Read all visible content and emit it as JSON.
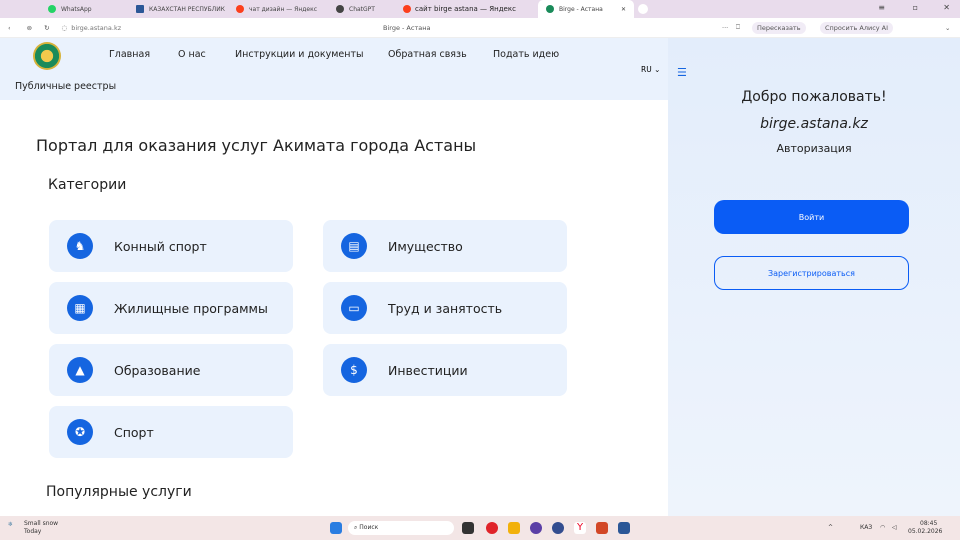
{
  "browser": {
    "tabs": [
      {
        "label": "WhatsApp",
        "color": "#25d366"
      },
      {
        "label": "КАЗАХСТАН РЕСПУБЛИК",
        "color": "#2b5797"
      },
      {
        "label": "чат дизайн — Яндекс",
        "color": "#fc3f1d"
      },
      {
        "label": "ChatGPT",
        "color": "#444"
      },
      {
        "label": "сайт birge astana — Яндекс",
        "color": "#fc3f1d"
      },
      {
        "label": "Birge - Астана",
        "color": "#1a8b5a"
      }
    ],
    "url": "birge.astana.kz",
    "page_title": "Birge - Астана",
    "retell": "Пересказать",
    "ask_alice": "Спросить Алису AI"
  },
  "header": {
    "nav": [
      "Главная",
      "О нас",
      "Инструкции и документы",
      "Обратная связь",
      "Подать идею"
    ],
    "public_registries": "Публичные реестры",
    "lang": "RU"
  },
  "main": {
    "title": "Портал для оказания услуг Акимата города Астаны",
    "categories_title": "Категории",
    "categories": [
      {
        "label": "Конный спорт",
        "icon": "horse-icon"
      },
      {
        "label": "Имущество",
        "icon": "property-icon"
      },
      {
        "label": "Жилищные программы",
        "icon": "building-icon"
      },
      {
        "label": "Труд и занятость",
        "icon": "briefcase-icon"
      },
      {
        "label": "Образование",
        "icon": "graduation-cap-icon"
      },
      {
        "label": "Инвестиции",
        "icon": "coins-icon"
      },
      {
        "label": "Спорт",
        "icon": "medal-icon"
      }
    ],
    "popular_title": "Популярные услуги"
  },
  "panel": {
    "welcome": "Добро пожаловать!",
    "site": "birge.astana.kz",
    "auth": "Авторизация",
    "login": "Войти",
    "register": "Зарегистрироваться"
  },
  "taskbar": {
    "weather": "Small snow",
    "weather_sub": "Today",
    "search": "Поиск",
    "lang": "КАЗ",
    "time": "08:45",
    "date": "05.02.2026"
  },
  "colors": {
    "accent": "#0a5cf5",
    "card_bg": "#eaf2fd"
  }
}
